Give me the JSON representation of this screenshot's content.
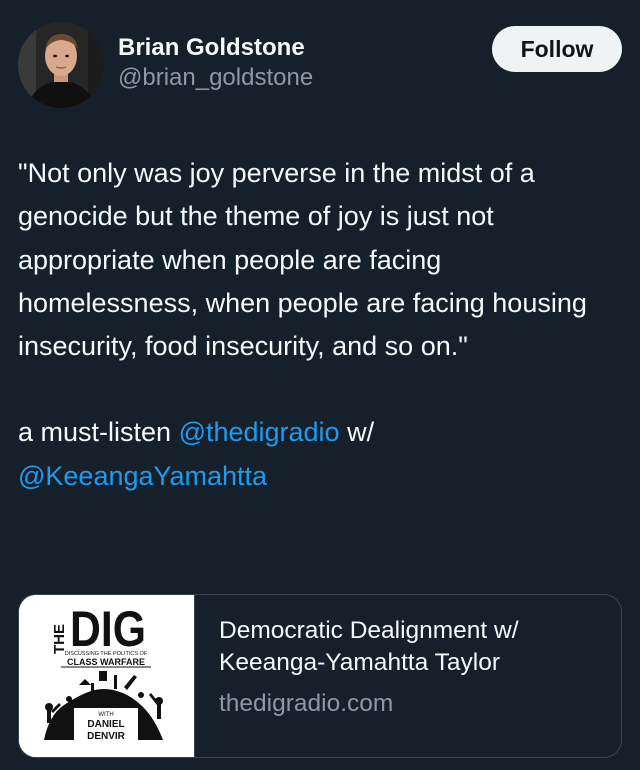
{
  "author": {
    "display_name": "Brian Goldstone",
    "handle": "@brian_goldstone"
  },
  "follow_button": {
    "label": "Follow"
  },
  "tweet": {
    "quote": "\"Not only was joy perverse in the midst of a genocide but the theme of joy is just not appropriate when people are facing homelessness, when people are facing housing insecurity, food insecurity, and so on.\"",
    "text_prefix": "a must-listen ",
    "mention_1": "@thedigradio",
    "text_mid": " w/",
    "mention_2": "@KeeangaYamahtta"
  },
  "link_card": {
    "title": "Democratic Dealignment w/ Keeanga-Yamahtta Taylor",
    "domain": "thedigradio.com",
    "thumbnail": {
      "logo_the": "THE",
      "logo_dig": "DIG",
      "tagline_1": "DISCUSSING   THE   POLITICS   OF",
      "tagline_2": "CLASS WARFARE",
      "with": "WITH",
      "host_first": "DANIEL",
      "host_last": "DENVIR"
    }
  },
  "colors": {
    "background": "#15202b",
    "text": "#f7f9f9",
    "secondary_text": "#8b98a5",
    "link": "#1d9bf0",
    "follow_bg": "#eff3f4",
    "border": "#38444d"
  }
}
